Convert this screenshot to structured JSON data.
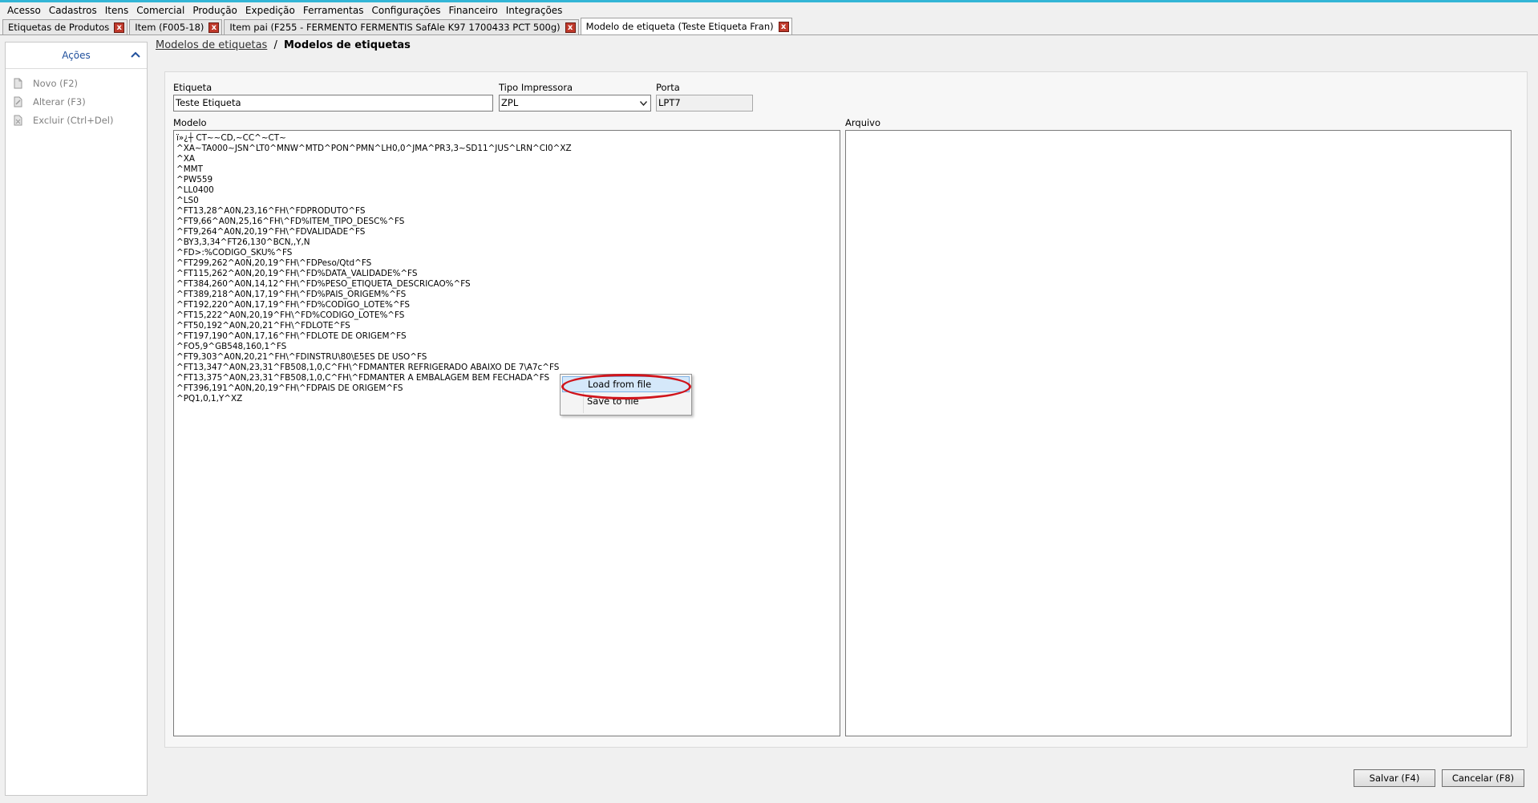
{
  "menu": [
    "Acesso",
    "Cadastros",
    "Itens",
    "Comercial",
    "Produção",
    "Expedição",
    "Ferramentas",
    "Configurações",
    "Financeiro",
    "Integrações"
  ],
  "tabs": [
    {
      "label": "Etiquetas de Produtos",
      "active": false
    },
    {
      "label": "Item (F005-18)",
      "active": false
    },
    {
      "label": "Item pai (F255 - FERMENTO FERMENTIS SafAle K97 1700433 PCT 500g)",
      "active": false
    },
    {
      "label": "Modelo de etiqueta (Teste Etiqueta Fran)",
      "active": true
    }
  ],
  "tab_close_glyph": "x",
  "actions": {
    "title": "Ações",
    "items": [
      {
        "label": "Novo (F2)",
        "icon": "new-document-icon"
      },
      {
        "label": "Alterar (F3)",
        "icon": "edit-document-icon"
      },
      {
        "label": "Excluir (Ctrl+Del)",
        "icon": "delete-document-icon"
      }
    ]
  },
  "breadcrumb": {
    "link": "Modelos de etiquetas",
    "separator": "/",
    "current": "Modelos de etiquetas"
  },
  "form": {
    "etiqueta_label": "Etiqueta",
    "etiqueta_value": "Teste Etiqueta",
    "tipo_label": "Tipo Impressora",
    "tipo_value": "ZPL",
    "porta_label": "Porta",
    "porta_value": "LPT7",
    "modelo_label": "Modelo",
    "arquivo_label": "Arquivo",
    "modelo_text": "ï»¿┼ CT~~CD,~CC^~CT~\n^XA~TA000~JSN^LT0^MNW^MTD^PON^PMN^LH0,0^JMA^PR3,3~SD11^JUS^LRN^CI0^XZ\n^XA\n^MMT\n^PW559\n^LL0400\n^LS0\n^FT13,28^A0N,23,16^FH\\^FDPRODUTO^FS\n^FT9,66^A0N,25,16^FH\\^FD%ITEM_TIPO_DESC%^FS\n^FT9,264^A0N,20,19^FH\\^FDVALIDADE^FS\n^BY3,3,34^FT26,130^BCN,,Y,N\n^FD>:%CODIGO_SKU%^FS\n^FT299,262^A0N,20,19^FH\\^FDPeso/Qtd^FS\n^FT115,262^A0N,20,19^FH\\^FD%DATA_VALIDADE%^FS\n^FT384,260^A0N,14,12^FH\\^FD%PESO_ETIQUETA_DESCRICAO%^FS\n^FT389,218^A0N,17,19^FH\\^FD%PAIS_ORIGEM%^FS\n^FT192,220^A0N,17,19^FH\\^FD%CODIGO_LOTE%^FS\n^FT15,222^A0N,20,19^FH\\^FD%CODIGO_LOTE%^FS\n^FT50,192^A0N,20,21^FH\\^FDLOTE^FS\n^FT197,190^A0N,17,16^FH\\^FDLOTE DE ORIGEM^FS\n^FO5,9^GB548,160,1^FS\n^FT9,303^A0N,20,21^FH\\^FDINSTRU\\80\\E5ES DE USO^FS\n^FT13,347^A0N,23,31^FB508,1,0,C^FH\\^FDMANTER REFRIGERADO ABAIXO DE 7\\A7c^FS\n^FT13,375^A0N,23,31^FB508,1,0,C^FH\\^FDMANTER A EMBALAGEM BEM FECHADA^FS\n^FT396,191^A0N,20,19^FH\\^FDPAIS DE ORIGEM^FS\n^PQ1,0,1,Y^XZ",
    "arquivo_text": ""
  },
  "context_menu": {
    "load": "Load from file",
    "save": "Save to file"
  },
  "buttons": {
    "save": "Salvar (F4)",
    "cancel": "Cancelar (F8)"
  },
  "colors": {
    "accent_line": "#33b5d6",
    "close_btn": "#c0392b",
    "annotation": "#d0141b",
    "actions_title": "#1f4f9c"
  }
}
